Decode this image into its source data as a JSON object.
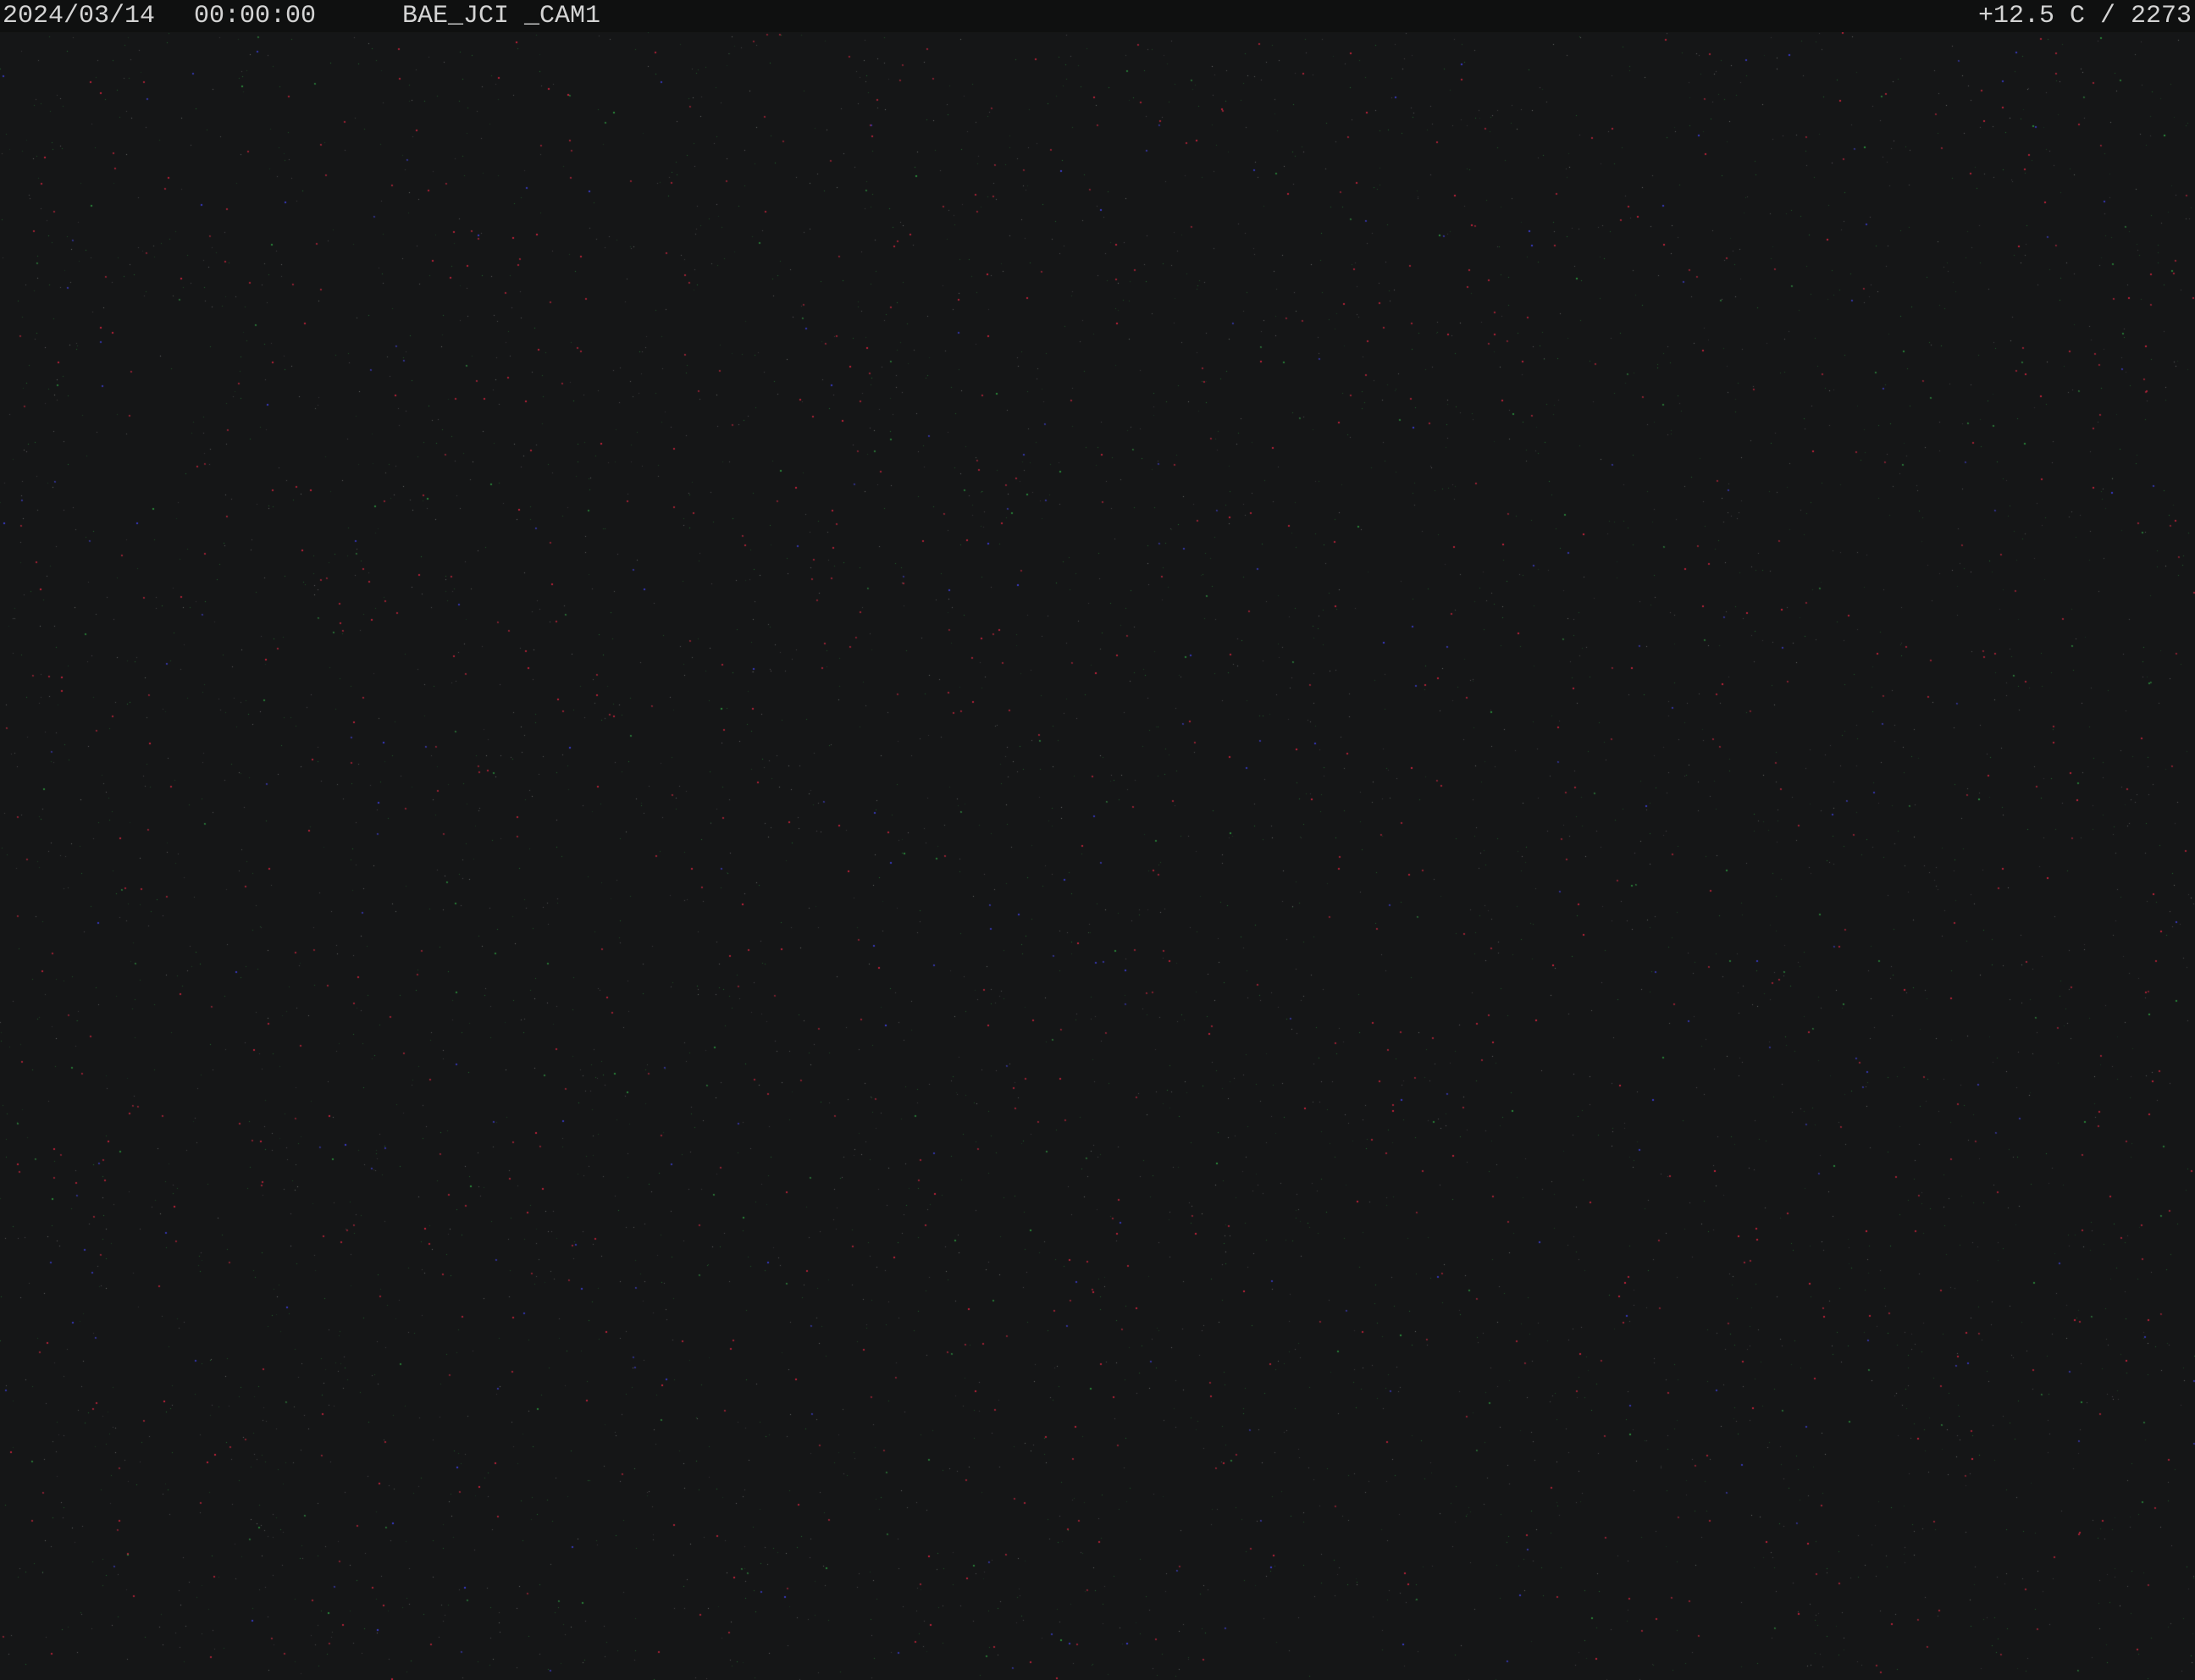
{
  "overlay": {
    "date": "2024/03/14",
    "time": "00:00:00",
    "camera_id": "BAE_JCI _CAM1",
    "sensor_readout": "+12.5 C / 2273"
  },
  "colors": {
    "background": "#151617",
    "overlay_bar": "#0f1010",
    "overlay_text": "#d4d4d4",
    "noise": [
      "#c0223a",
      "#2a8a3a",
      "#3a3ac8",
      "#8a8a8a"
    ]
  }
}
